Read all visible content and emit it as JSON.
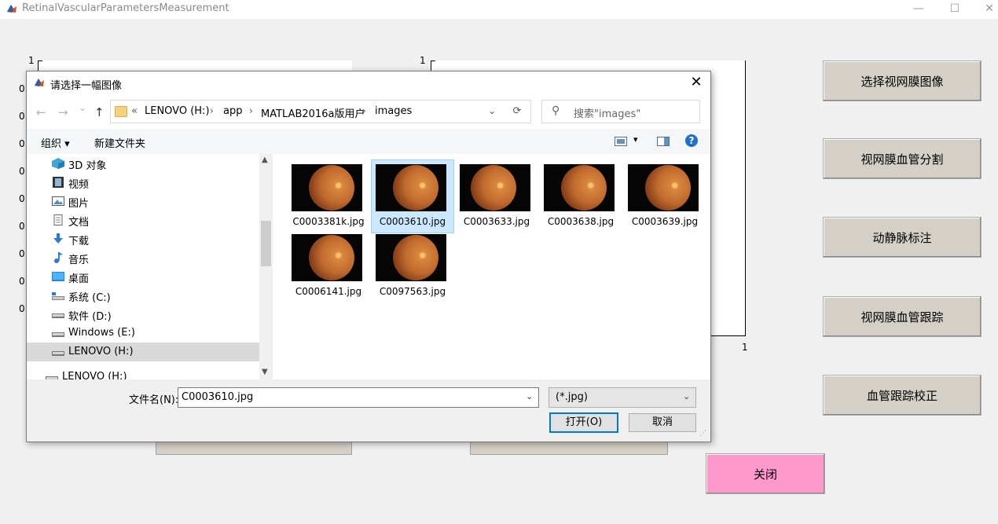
{
  "window": {
    "title": "RetinalVascularParametersMeasurement",
    "minimize": "—",
    "maximize": "☐",
    "close": "✕"
  },
  "axes_left": {
    "top_tick": "1",
    "y_ticks": [
      "0.",
      "0.",
      "0.",
      "0.",
      "0.",
      "0.",
      "0.",
      "0.",
      "0."
    ]
  },
  "axes_right": {
    "top_tick": "1",
    "x_end_tick": "1"
  },
  "side_buttons": [
    {
      "label": "选择视网膜图像"
    },
    {
      "label": "视网膜血管分割"
    },
    {
      "label": "动静脉标注"
    },
    {
      "label": "视网膜血管跟踪"
    },
    {
      "label": "血管跟踪校正"
    }
  ],
  "close_button": "关闭",
  "dialog": {
    "title": "请选择一幅图像",
    "close": "✕",
    "nav": {
      "back": "←",
      "forward": "→",
      "recent": "⌄",
      "up": "↑"
    },
    "breadcrumb": [
      "«",
      "LENOVO (H:)",
      "app",
      "MATLAB2016a版用户",
      "images"
    ],
    "breadcrumb_sep": "›",
    "address_dropdown": "⌄",
    "refresh": "⟳",
    "search_placeholder": "搜索\"images\"",
    "toolbar": {
      "organize": "组织 ▾",
      "new_folder": "新建文件夹",
      "view": "▾",
      "help": "?"
    },
    "nav_items": [
      {
        "label": "3D 对象",
        "icon": "3d-objects-icon"
      },
      {
        "label": "视频",
        "icon": "video-icon"
      },
      {
        "label": "图片",
        "icon": "pictures-icon"
      },
      {
        "label": "文档",
        "icon": "documents-icon"
      },
      {
        "label": "下载",
        "icon": "download-icon"
      },
      {
        "label": "音乐",
        "icon": "music-icon"
      },
      {
        "label": "桌面",
        "icon": "desktop-icon"
      },
      {
        "label": "系统 (C:)",
        "icon": "drive-c-icon"
      },
      {
        "label": "软件 (D:)",
        "icon": "drive-icon"
      },
      {
        "label": "Windows (E:)",
        "icon": "drive-icon"
      },
      {
        "label": "LENOVO (H:)",
        "icon": "drive-icon",
        "selected": true
      },
      {
        "label": "LENOVO (H:)",
        "icon": "drive-icon"
      }
    ],
    "files": [
      {
        "name": "C0003381k.jpg"
      },
      {
        "name": "C0003610.jpg",
        "selected": true
      },
      {
        "name": "C0003633.jpg"
      },
      {
        "name": "C0003638.jpg"
      },
      {
        "name": "C0003639.jpg"
      },
      {
        "name": "C0006141.jpg"
      },
      {
        "name": "C0097563.jpg"
      }
    ],
    "filename_label": "文件名(N):",
    "filename_value": "C0003610.jpg",
    "filetype_value": "(*.jpg)",
    "dropdown_arrow": "⌄",
    "open_button": "打开(O)",
    "cancel_button": "取消"
  }
}
